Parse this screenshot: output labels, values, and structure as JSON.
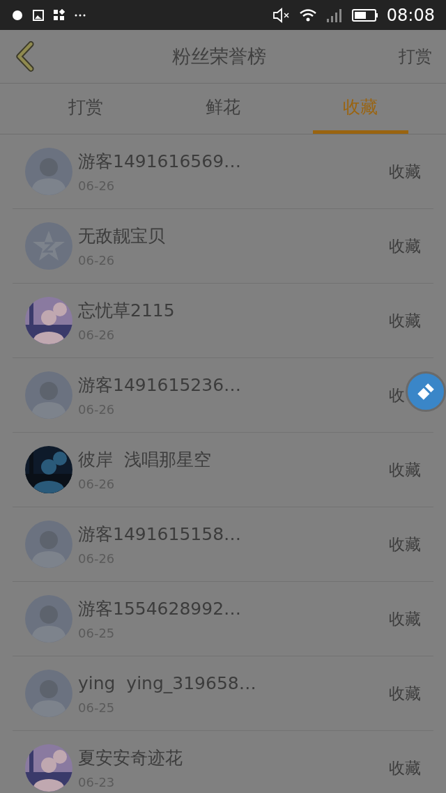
{
  "status_bar": {
    "time": "08:08"
  },
  "header": {
    "title": "粉丝荣誉榜",
    "action": "打赏"
  },
  "tabs": [
    {
      "label": "打赏",
      "selected": false
    },
    {
      "label": "鲜花",
      "selected": false
    },
    {
      "label": "收藏",
      "selected": true
    }
  ],
  "rows": [
    {
      "name": "游客1491616569…",
      "date": "06-26",
      "action": "收藏",
      "kind": "default"
    },
    {
      "name": "无敌靓宝贝",
      "date": "06-26",
      "action": "收藏",
      "kind": "star"
    },
    {
      "name": "忘忧草2115",
      "date": "06-26",
      "action": "收藏",
      "kind": "picture"
    },
    {
      "name": "游客1491615236…",
      "date": "06-26",
      "action": "收",
      "kind": "default"
    },
    {
      "name": "彼岸  浅唱那星空",
      "date": "06-26",
      "action": "收藏",
      "kind": "picture"
    },
    {
      "name": "游客1491615158…",
      "date": "06-26",
      "action": "收藏",
      "kind": "default"
    },
    {
      "name": "游客1554628992…",
      "date": "06-25",
      "action": "收藏",
      "kind": "default"
    },
    {
      "name": "ying  ying_319658…",
      "date": "06-25",
      "action": "收藏",
      "kind": "default"
    },
    {
      "name": "夏安安奇迹花",
      "date": "06-23",
      "action": "收藏",
      "kind": "picture"
    }
  ]
}
